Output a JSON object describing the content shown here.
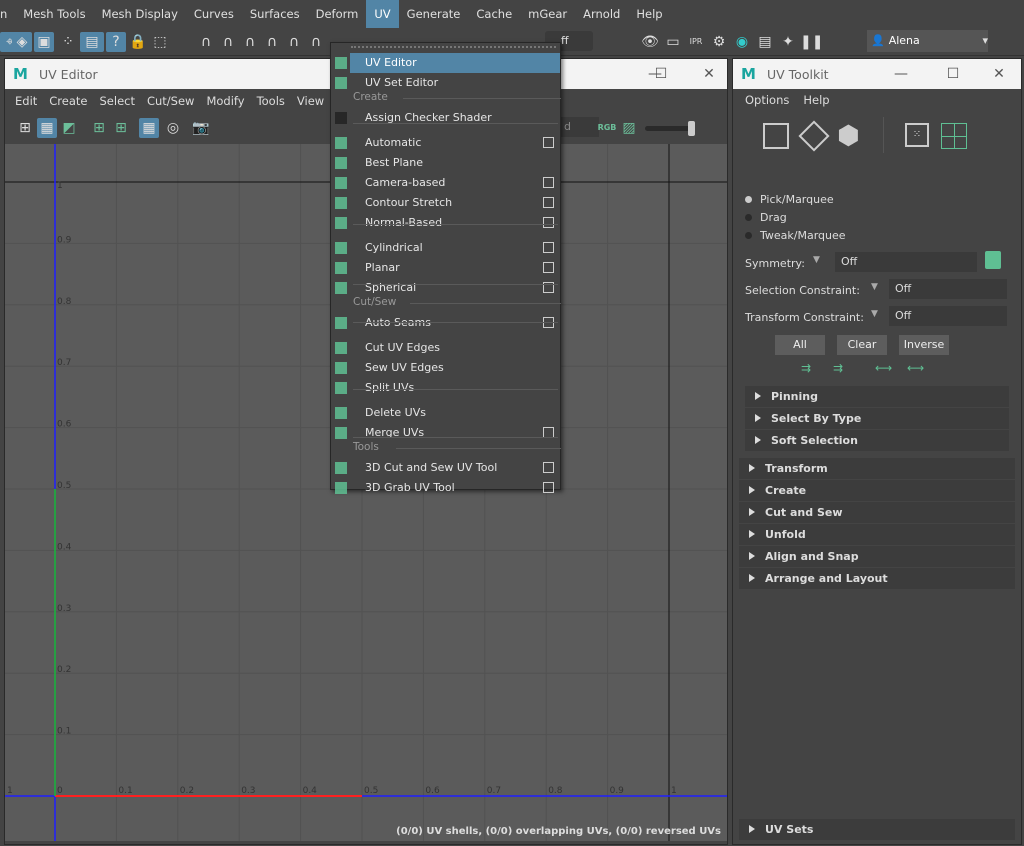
{
  "main_menu": [
    "n",
    "Mesh Tools",
    "Mesh Display",
    "Curves",
    "Surfaces",
    "Deform",
    "UV",
    "Generate",
    "Cache",
    "mGear",
    "Arnold",
    "Help"
  ],
  "main_menu_active": "UV",
  "status_line": {
    "field_value": "ff",
    "user": "Alena Leontyeva"
  },
  "uv_editor": {
    "title": "UV Editor",
    "menu": [
      "Edit",
      "Create",
      "Select",
      "Cut/Sew",
      "Modify",
      "Tools",
      "View"
    ],
    "filter_placeholder": "d",
    "rgb_label": "RGB",
    "u_ticks": [
      "1",
      "0",
      "0.1",
      "0.2",
      "0.3",
      "0.4",
      "0.5",
      "0.6",
      "0.7",
      "0.8",
      "0.9",
      "1"
    ],
    "v_ticks": [
      "1",
      "0.9",
      "0.8",
      "0.7",
      "0.6",
      "0.5",
      "0.4",
      "0.3",
      "0.2",
      "0.1"
    ],
    "status": "(0/0) UV shells, (0/0) overlapping UVs, (0/0) reversed UVs"
  },
  "uv_menu": {
    "items": [
      {
        "label": "UV Editor",
        "icon": "uv-editor-icon",
        "option_box": false,
        "highlighted": true
      },
      {
        "label": "UV Set Editor",
        "icon": "uv-set-editor-icon",
        "option_box": false
      },
      {
        "section": "Create"
      },
      {
        "label": "Assign Checker Shader",
        "icon": "checker-icon",
        "option_box": false
      },
      {
        "label": "Automatic",
        "icon": "automatic-icon",
        "option_box": true
      },
      {
        "label": "Best Plane",
        "icon": "best-plane-icon",
        "option_box": false
      },
      {
        "label": "Camera-based",
        "icon": "camera-icon",
        "option_box": true
      },
      {
        "label": "Contour Stretch",
        "icon": "contour-icon",
        "option_box": true
      },
      {
        "label": "Normal-Based",
        "icon": "normal-icon",
        "option_box": true
      },
      {
        "label": "Cylindrical",
        "icon": "cylindrical-icon",
        "option_box": true
      },
      {
        "label": "Planar",
        "icon": "planar-icon",
        "option_box": true
      },
      {
        "label": "Spherical",
        "icon": "spherical-icon",
        "option_box": true
      },
      {
        "section": "Cut/Sew"
      },
      {
        "label": "Auto Seams",
        "icon": "auto-seams-icon",
        "option_box": true
      },
      {
        "label": "Cut UV Edges",
        "icon": "cut-icon",
        "option_box": false
      },
      {
        "label": "Sew UV Edges",
        "icon": "sew-icon",
        "option_box": false
      },
      {
        "label": "Split UVs",
        "icon": "split-icon",
        "option_box": false
      },
      {
        "label": "Delete UVs",
        "icon": "delete-icon",
        "option_box": false
      },
      {
        "label": "Merge UVs",
        "icon": "merge-icon",
        "option_box": true
      },
      {
        "section": "Tools"
      },
      {
        "label": "3D Cut and Sew UV Tool",
        "icon": "cut-sew-tool-icon",
        "option_box": true
      },
      {
        "label": "3D Grab UV Tool",
        "icon": "grab-tool-icon",
        "option_box": true
      }
    ]
  },
  "uv_toolkit": {
    "title": "UV Toolkit",
    "menu": [
      "Options",
      "Help"
    ],
    "modes": [
      "Pick/Marquee",
      "Drag",
      "Tweak/Marquee"
    ],
    "selected_mode": "Pick/Marquee",
    "symmetry": {
      "label": "Symmetry:",
      "value": "Off"
    },
    "selection_constraint": {
      "label": "Selection Constraint:",
      "value": "Off"
    },
    "transform_constraint": {
      "label": "Transform Constraint:",
      "value": "Off"
    },
    "buttons": [
      "All",
      "Clear",
      "Inverse"
    ],
    "sub_sections": [
      "Pinning",
      "Select By Type",
      "Soft Selection"
    ],
    "sections": [
      "Transform",
      "Create",
      "Cut and Sew",
      "Unfold",
      "Align and Snap",
      "Arrange and Layout"
    ],
    "bottom_section": "UV Sets"
  },
  "colors": {
    "highlight": "#5285a6",
    "accent_green": "#5fbf93",
    "u_axis": "#ff2020",
    "v_axis": "#2020ff"
  }
}
